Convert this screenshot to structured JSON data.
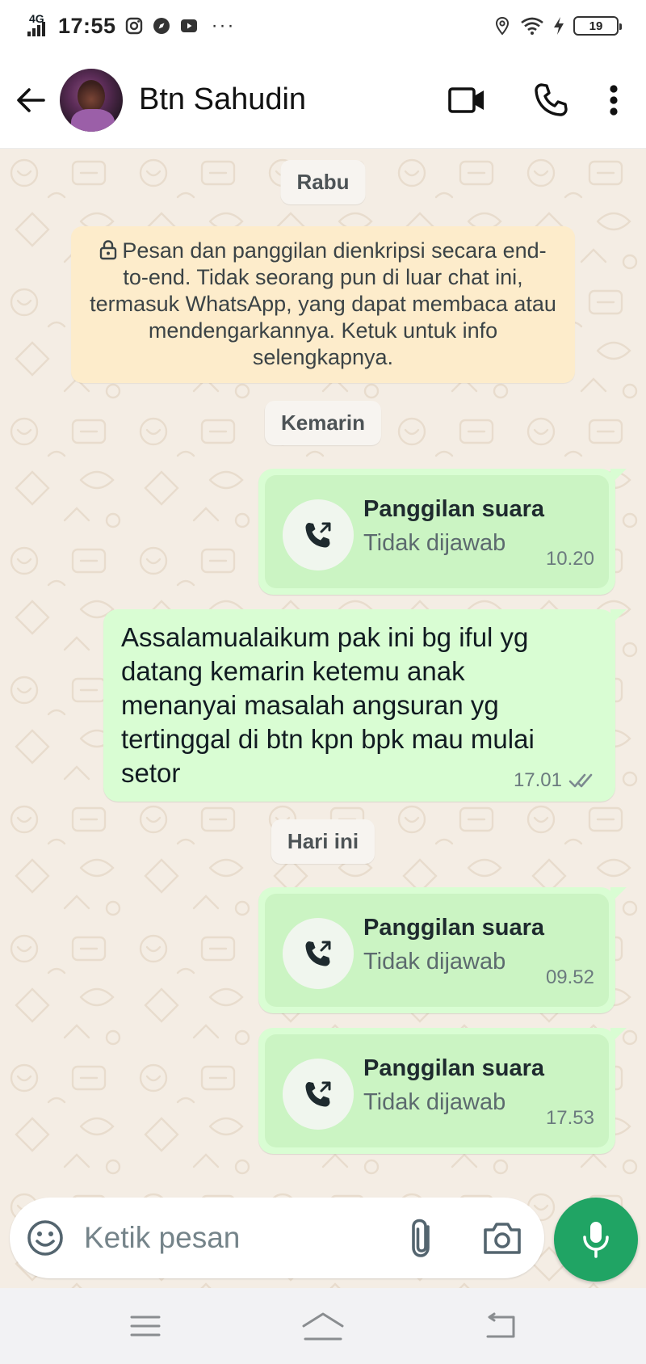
{
  "status_bar": {
    "network": "4G",
    "time": "17:55",
    "battery": "19",
    "more": "···"
  },
  "header": {
    "contact_name": "Btn Sahudin"
  },
  "chat": {
    "date_chips": {
      "rabu": "Rabu",
      "kemarin": "Kemarin",
      "hari_ini": "Hari ini"
    },
    "encryption_notice": "Pesan dan panggilan dienkripsi secara end-to-end. Tidak seorang pun di luar chat ini, termasuk WhatsApp, yang dapat membaca atau mendengarkannya. Ketuk untuk info selengkapnya.",
    "calls": [
      {
        "title": "Panggilan suara",
        "status": "Tidak dijawab",
        "time": "10.20"
      },
      {
        "title": "Panggilan suara",
        "status": "Tidak dijawab",
        "time": "09.52"
      },
      {
        "title": "Panggilan suara",
        "status": "Tidak dijawab",
        "time": "17.53"
      }
    ],
    "text_message": {
      "body": "Assalamualaikum pak ini bg iful yg datang kemarin ketemu anak menanyai masalah angsuran yg tertinggal di btn kpn bpk mau mulai setor",
      "time": "17.01",
      "status_icon": "double-check-icon"
    }
  },
  "input": {
    "placeholder": "Ketik pesan"
  },
  "colors": {
    "outgoing_bubble": "#d9fdd3",
    "call_inner": "#cbf4c3",
    "mic_button": "#20a464",
    "chat_background": "#f4ede4",
    "encryption_notice_bg": "#fdeccb"
  }
}
